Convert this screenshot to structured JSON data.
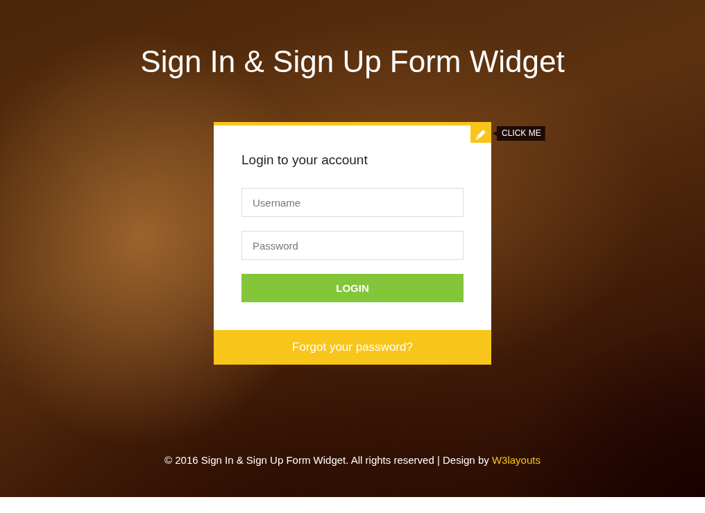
{
  "header": {
    "title": "Sign In & Sign Up Form Widget"
  },
  "form": {
    "tooltip": "CLICK ME",
    "heading": "Login to your account",
    "fields": [
      {
        "placeholder": "Username"
      },
      {
        "placeholder": "Password"
      }
    ],
    "submit": "LOGIN",
    "forgot_link": "Forgot your password?"
  },
  "footer": {
    "text": "© 2016 Sign In & Sign Up Form Widget. All rights reserved | Design by",
    "link": "W3layouts"
  }
}
